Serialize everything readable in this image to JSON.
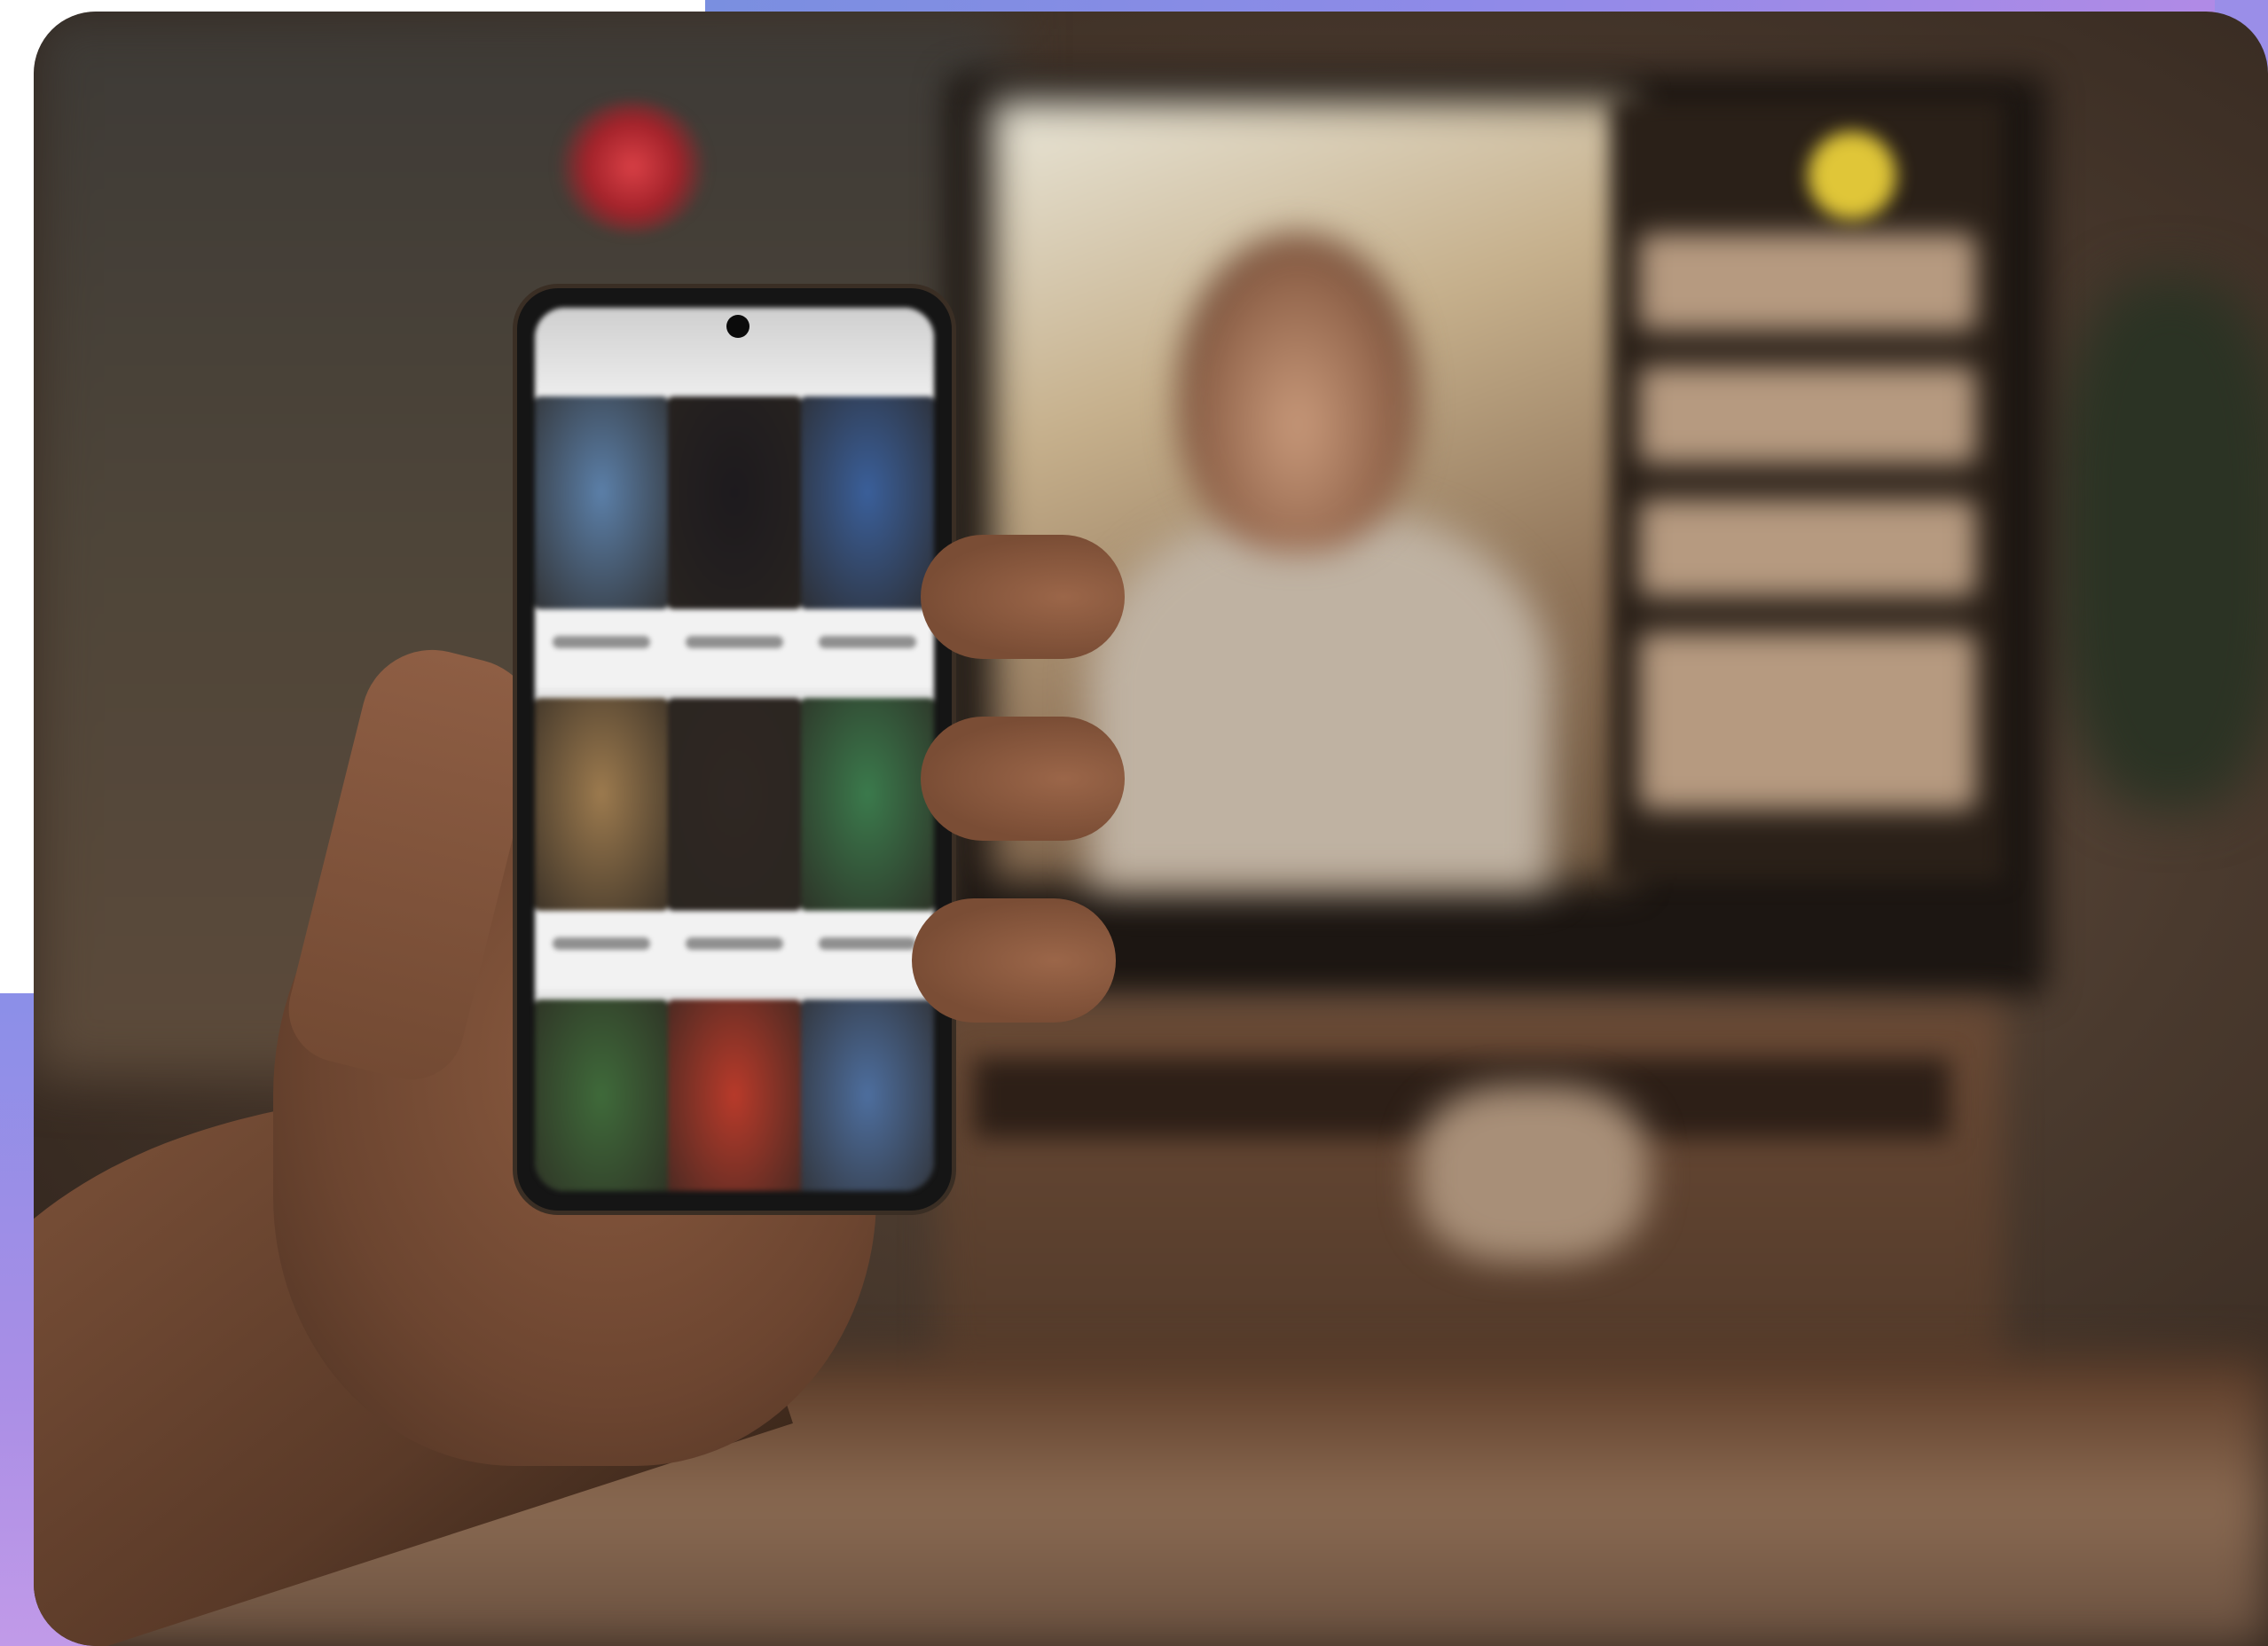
{
  "image": {
    "description_colors": {
      "page_background": "#ffffff",
      "gradient_accent_start": "#7a8fe0",
      "gradient_accent_end": "#b38ae6",
      "lamp_red": "#d94046",
      "tv_indicator_yellow": "#e0c638"
    },
    "phone_grid": {
      "rows": 3,
      "columns": 3,
      "tile_colors": [
        [
          "#5b7fa8",
          "#1d1a1e",
          "#3a5f9a"
        ],
        [
          "#9c7a4e",
          "#2f2723",
          "#3b7a4c"
        ],
        [
          "#3f6a3a",
          "#b83a2a",
          "#4d6e9e"
        ]
      ]
    }
  }
}
